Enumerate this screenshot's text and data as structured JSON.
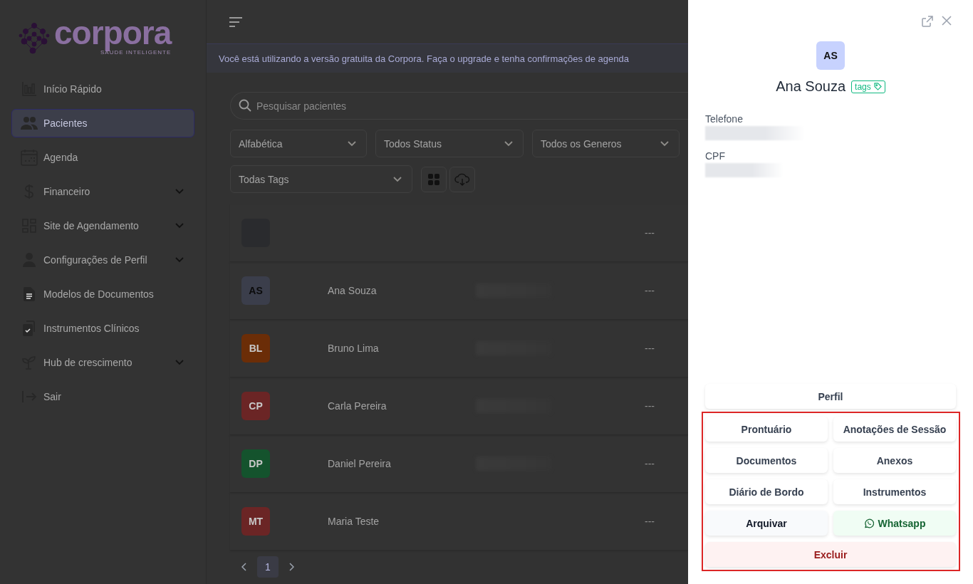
{
  "sidebar": {
    "logo": {
      "name": "corpora",
      "tagline": "SAUDE INTELIGENTE"
    },
    "items": [
      {
        "label": "Início Rápido",
        "selected": false,
        "has_submenu": false
      },
      {
        "label": "Pacientes",
        "selected": true,
        "has_submenu": false
      },
      {
        "label": "Agenda",
        "selected": false,
        "has_submenu": false
      },
      {
        "label": "Financeiro",
        "selected": false,
        "has_submenu": true
      },
      {
        "label": "Site de Agendamento",
        "selected": false,
        "has_submenu": true
      },
      {
        "label": "Configurações de Perfil",
        "selected": false,
        "has_submenu": true
      },
      {
        "label": "Modelos de Documentos",
        "selected": false,
        "has_submenu": false
      },
      {
        "label": "Instrumentos Clínicos",
        "selected": false,
        "has_submenu": false
      },
      {
        "label": "Hub de crescimento",
        "selected": false,
        "has_submenu": true
      },
      {
        "label": "Sair",
        "selected": false,
        "has_submenu": false
      }
    ]
  },
  "banner": "Você está utilizando a versão gratuita da Corpora. Faça o upgrade e tenha confirmações de agenda",
  "search": {
    "placeholder": "Pesquisar pacientes"
  },
  "filters": [
    {
      "value": "Alfabética"
    },
    {
      "value": "Todos Status"
    },
    {
      "value": "Todos os Generos"
    },
    {
      "value": "Todas Tags"
    }
  ],
  "patients": [
    {
      "color": "#2a2b2e",
      "phone_hidden": false,
      "last": "---"
    },
    {
      "initials": "AS",
      "name": "Ana Souza",
      "color": "#3b3e4b",
      "phone_hidden": true,
      "last": "---"
    },
    {
      "initials": "BL",
      "name": "Bruno Lima",
      "color": "#6b2d07",
      "phone_hidden": true,
      "last": "---"
    },
    {
      "initials": "CP",
      "name": "Carla Pereira",
      "color": "#6b2525",
      "phone_hidden": true,
      "last": "---"
    },
    {
      "initials": "DP",
      "name": "Daniel Pereira",
      "color": "#14532d",
      "phone_hidden": true,
      "last": "---"
    },
    {
      "initials": "MT",
      "name": "Maria Teste",
      "color": "#6b2525",
      "phone_hidden": false,
      "last": "---"
    }
  ],
  "pagination": {
    "pages": [
      {
        "label": "1",
        "selected": true
      }
    ]
  },
  "drawer": {
    "initials": "AS",
    "name": "Ana Souza",
    "tag": "tags",
    "fields": [
      {
        "label": "Telefone"
      },
      {
        "label": "CPF"
      }
    ],
    "profile_button": "Perfil",
    "actions": [
      {
        "label": "Prontuário",
        "kind": "default"
      },
      {
        "label": "Anotações de Sessão",
        "kind": "default"
      },
      {
        "label": "Documentos",
        "kind": "default"
      },
      {
        "label": "Anexos",
        "kind": "default"
      },
      {
        "label": "Diário de Bordo",
        "kind": "default"
      },
      {
        "label": "Instrumentos",
        "kind": "default"
      },
      {
        "label": "Arquivar",
        "kind": "neutral"
      },
      {
        "label": "Whatsapp",
        "kind": "success"
      },
      {
        "label": "Excluir",
        "kind": "danger"
      }
    ]
  }
}
